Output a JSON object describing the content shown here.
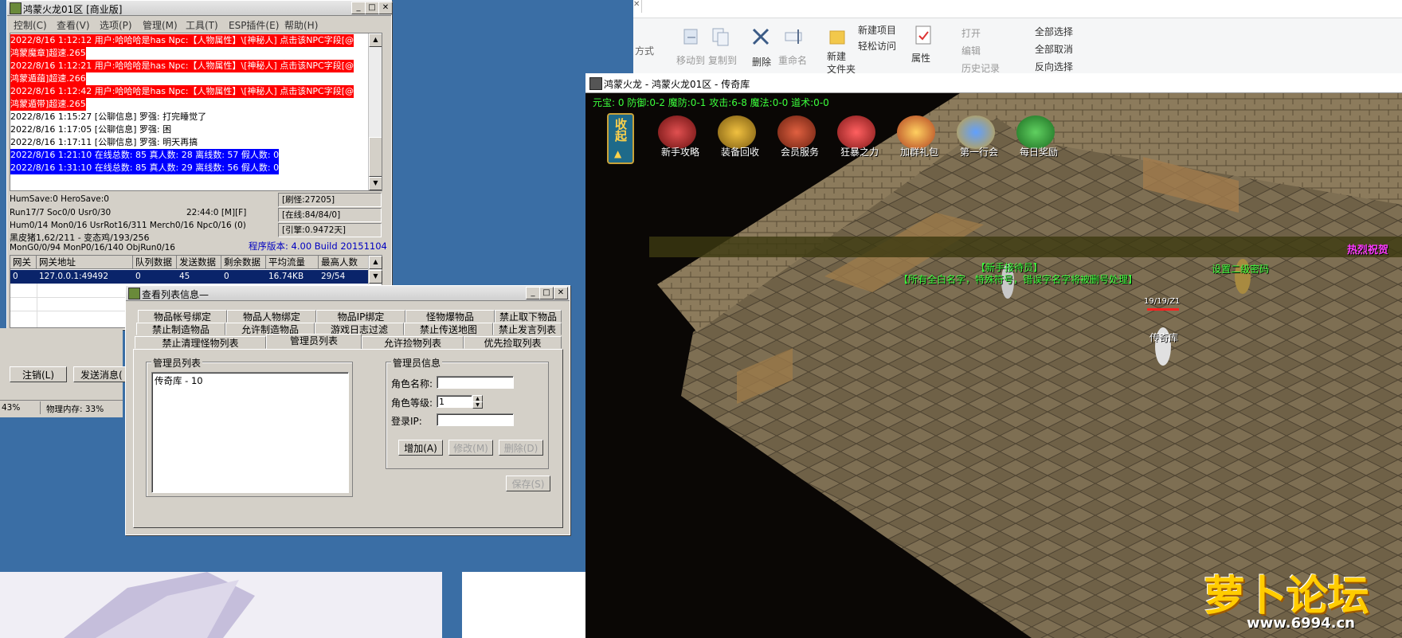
{
  "explorer": {
    "partial_label": "方式",
    "move_to": "移动到",
    "copy_to": "复制到",
    "delete": "删除",
    "rename": "重命名",
    "new_folder": "新建\n文件夹",
    "new_item": "新建项目",
    "easy_access": "轻松访问",
    "properties": "属性",
    "open": "打开",
    "edit": "编辑",
    "history": "历史记录",
    "select_all": "全部选择",
    "select_none": "全部取消",
    "invert_selection": "反向选择"
  },
  "server": {
    "title": "鸿蒙火龙01区 [商业版]",
    "menu": [
      "控制(C)",
      "查看(V)",
      "选项(P)",
      "管理(M)",
      "工具(T)",
      "ESP插件(E)",
      "帮助(H)"
    ],
    "log": [
      {
        "text": "2022/8/16 1:12:12 用户:哈哈哈是has Npc:【人物属性】\\[神秘人] 点击该NPC字段[@",
        "style": "red"
      },
      {
        "text": "鸿蒙魔章]超速.265",
        "style": "red"
      },
      {
        "text": "2022/8/16 1:12:21 用户:哈哈哈是has Npc:【人物属性】\\[神秘人] 点击该NPC字段[@",
        "style": "red"
      },
      {
        "text": "鸿蒙遁蕴]超速.266",
        "style": "red"
      },
      {
        "text": "2022/8/16 1:12:42 用户:哈哈哈是has Npc:【人物属性】\\[神秘人] 点击该NPC字段[@",
        "style": "red"
      },
      {
        "text": "鸿蒙遁带]超速.265",
        "style": "red"
      },
      {
        "text": "2022/8/16 1:15:27 [公聊信息] 罗强: 打完睡觉了",
        "style": "plain"
      },
      {
        "text": "2022/8/16 1:17:05 [公聊信息] 罗强: 困",
        "style": "plain"
      },
      {
        "text": "2022/8/16 1:17:11 [公聊信息] 罗强: 明天再搞",
        "style": "plain"
      },
      {
        "text": "2022/8/16 1:21:10 在线总数: 85 真人数: 28 离线数: 57 假人数: 0",
        "style": "blue"
      },
      {
        "text": "2022/8/16 1:31:10 在线总数: 85 真人数: 29 离线数: 56 假人数: 0",
        "style": "blue"
      }
    ],
    "stats": {
      "line1": "HumSave:0 HeroSave:0",
      "line2": "Run17/7 Soc0/0 Usr0/30",
      "time": "22:44:0 [M][F]",
      "line3": "Hum0/14 Mon0/16 UsrRot16/311 Merch0/16 Npc0/16 (0)",
      "line4": "黑皮猪1,62/211 - 变态鸡/193/256",
      "line5": "MonG0/0/94 MonP0/16/140 ObjRun0/16",
      "spawn": "[刷怪:27205]",
      "online": "[在线:84/84/0]",
      "engine": "[引擎:0.9472天]",
      "version": "程序版本: 4.00 Build 20151104"
    },
    "gateway_columns": [
      "网关",
      "网关地址",
      "队列数据",
      "发送数据",
      "剩余数据",
      "平均流量",
      "最高人数"
    ],
    "gateway_rows": [
      [
        "0",
        "127.0.0.1:49492",
        "0",
        "45",
        "0",
        "16.74KB",
        "29/54"
      ]
    ],
    "logout_button": "注销(L)",
    "send_button": "发送消息(",
    "cpu": "43%",
    "mem": "物理内存: 33%"
  },
  "dialog": {
    "title": "查看列表信息—",
    "tabs_row1": [
      "物品帐号绑定",
      "物品人物绑定",
      "物品IP绑定",
      "怪物爆物品",
      "禁止取下物品"
    ],
    "tabs_row2": [
      "禁止制造物品",
      "允许制造物品",
      "游戏日志过滤",
      "禁止传送地图",
      "禁止发言列表"
    ],
    "tabs_row3": [
      "禁止清理怪物列表",
      "管理员列表",
      "允许捡物列表",
      "优先捡取列表"
    ],
    "admin_list_title": "管理员列表",
    "admin_list": [
      "传奇库 - 10"
    ],
    "admin_info_title": "管理员信息",
    "role_name_label": "角色名称:",
    "role_level_label": "角色等级:",
    "role_level_value": "1",
    "login_ip_label": "登录IP:",
    "add_button": "增加(A)",
    "edit_button": "修改(M)",
    "delete_button": "删除(D)",
    "save_button": "保存(S)"
  },
  "game": {
    "title": "鸿蒙火龙 - 鸿蒙火龙01区 - 传奇库",
    "hud": "元宝: 0 防御:0-2 魔防:0-1 攻击:6-8 魔法:0-0 道术:0-0",
    "collapse": "收起",
    "icons": [
      "新手攻略",
      "装备回收",
      "会员服务",
      "狂暴之力",
      "加群礼包",
      "第一行会",
      "每日奖励"
    ],
    "banner_text": "热烈祝贺",
    "npc1_name": "【新手接待员】",
    "npc1_desc": "【所有全白名字，特殊符号，错误字名字将被删号处理】",
    "npc2_name": "设置二级密码",
    "player_hp": "19/19/Z1",
    "player_name": "传奇库"
  },
  "watermark": {
    "brand": "萝卜论坛",
    "url": "www.6994.cn"
  },
  "colors": {
    "desktop": "#3a6ea5",
    "log_red": "#ff0000",
    "log_blue": "#0000ff",
    "hud_green": "#3cff3c",
    "win_face": "#d4d0c8"
  }
}
